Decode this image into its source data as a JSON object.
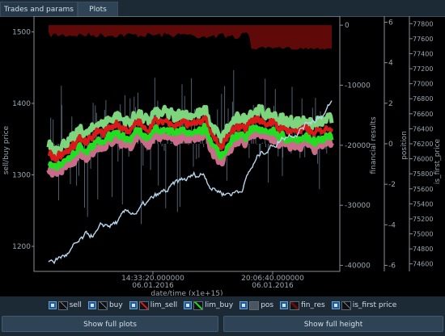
{
  "tabs": [
    {
      "label": "Trades and params",
      "active": false
    },
    {
      "label": "Plots",
      "active": true
    }
  ],
  "chart_data": {
    "type": "line",
    "x_tick_labels": [
      {
        "time": "14:33:20.000000",
        "date": "06.01.2016"
      },
      {
        "time": "20:06:40.000000",
        "date": "06.01.2016"
      }
    ],
    "xlabel": "date/time (x1e+15)",
    "axes": [
      {
        "label": "sell/buy price",
        "ticks": [
          "1200",
          "1300",
          "1400",
          "1500"
        ],
        "ylim": [
          1165,
          1522
        ]
      },
      {
        "label": "financial results",
        "ticks": [
          "0",
          "-10000",
          "-20000",
          "-30000",
          "-40000"
        ],
        "ylim": [
          -41000,
          1500
        ]
      },
      {
        "label": "position",
        "ticks": [
          "6",
          "4",
          "2",
          "0",
          "-2",
          "-4",
          "-6"
        ],
        "ylim": [
          -6.3,
          6.3
        ]
      },
      {
        "label": "is_first_price",
        "ticks": [
          "77800",
          "77600",
          "77400",
          "77200",
          "77000",
          "76800",
          "76600",
          "76400",
          "76200",
          "76000",
          "75800",
          "75600",
          "75400",
          "75200",
          "75000",
          "74800",
          "74600"
        ],
        "ylim": [
          74500,
          77900
        ]
      }
    ],
    "series": [
      {
        "name": "sell"
      },
      {
        "name": "buy"
      },
      {
        "name": "lim_sell"
      },
      {
        "name": "lim_buy"
      },
      {
        "name": "pos"
      },
      {
        "name": "fin_res"
      },
      {
        "name": "is_first price"
      }
    ],
    "colors": {
      "lim_sell": "#d81a1a",
      "lim_buy": "#22dd22",
      "sell": "#7dd67d",
      "buy": "#c86c8a",
      "pos": "#64788a",
      "fin_res": "#6a0a0a",
      "is_first_price": "#b8d6ec"
    }
  },
  "legend": [
    {
      "label": "sell",
      "color": "#000000"
    },
    {
      "label": "buy",
      "color": "#000000"
    },
    {
      "label": "lim_sell",
      "color": "#d81a1a"
    },
    {
      "label": "lim_buy",
      "color": "#22dd22"
    },
    {
      "label": "pos",
      "color": "solid"
    },
    {
      "label": "fin_res",
      "color": "#6a0a0a"
    },
    {
      "label": "is_first price",
      "color": "#000000"
    }
  ],
  "buttons": {
    "full_plots": "Show full plots",
    "full_height": "Show full height"
  }
}
